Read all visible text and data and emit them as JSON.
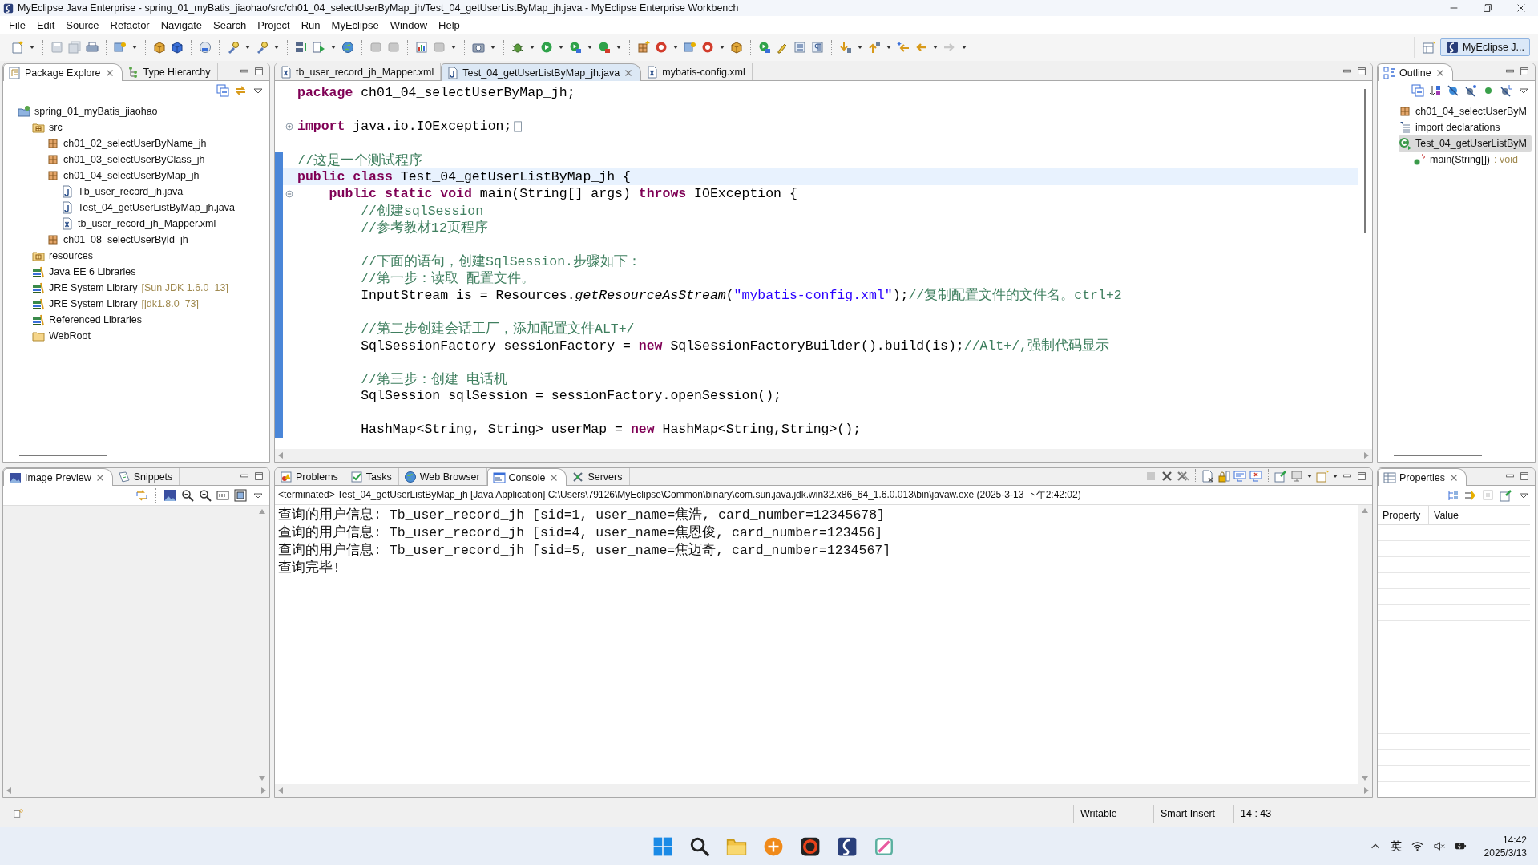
{
  "window": {
    "title": "MyEclipse Java Enterprise - spring_01_myBatis_jiaohao/src/ch01_04_selectUserByMap_jh/Test_04_getUserListByMap_jh.java - MyEclipse Enterprise Workbench"
  },
  "menu": [
    "File",
    "Edit",
    "Source",
    "Refactor",
    "Navigate",
    "Search",
    "Project",
    "Run",
    "MyEclipse",
    "Window",
    "Help"
  ],
  "perspective": {
    "label": "MyEclipse J...",
    "selected": true
  },
  "package_explorer": {
    "tabs": [
      {
        "kind": "package-explorer",
        "label": "Package Explore",
        "selected": true
      },
      {
        "kind": "hierarchy",
        "label": "Type Hierarchy",
        "selected": false
      }
    ],
    "tree": [
      {
        "kind": "project",
        "label": "spring_01_myBatis_jiaohao",
        "children": [
          {
            "kind": "source-folder",
            "label": "src",
            "children": [
              {
                "kind": "package",
                "label": "ch01_02_selectUserByName_jh"
              },
              {
                "kind": "package",
                "label": "ch01_03_selectUserByClass_jh"
              },
              {
                "kind": "package",
                "label": "ch01_04_selectUserByMap_jh",
                "children": [
                  {
                    "kind": "java",
                    "label": "Tb_user_record_jh.java"
                  },
                  {
                    "kind": "java",
                    "label": "Test_04_getUserListByMap_jh.java"
                  },
                  {
                    "kind": "xml",
                    "label": "tb_user_record_jh_Mapper.xml"
                  }
                ]
              },
              {
                "kind": "package",
                "label": "ch01_08_selectUserById_jh"
              }
            ]
          },
          {
            "kind": "source-folder",
            "label": "resources"
          },
          {
            "kind": "library",
            "label": "Java EE 6 Libraries"
          },
          {
            "kind": "library",
            "label": "JRE System Library",
            "detail": "[Sun JDK 1.6.0_13]"
          },
          {
            "kind": "library",
            "label": "JRE System Library",
            "detail": "[jdk1.8.0_73]"
          },
          {
            "kind": "library",
            "label": "Referenced Libraries"
          },
          {
            "kind": "folder",
            "label": "WebRoot"
          }
        ]
      }
    ]
  },
  "editor": {
    "tabs": [
      {
        "kind": "xml",
        "label": "tb_user_record_jh_Mapper.xml",
        "selected": false
      },
      {
        "kind": "java",
        "label": "Test_04_getUserListByMap_jh.java",
        "selected": true
      },
      {
        "kind": "xml",
        "label": "mybatis-config.xml",
        "selected": false
      }
    ],
    "lines": [
      {
        "current": false,
        "range": false,
        "segments": [
          {
            "kind": "keyword",
            "text": "package"
          },
          {
            "kind": "plain",
            "text": " ch01_04_selectUserByMap_jh;"
          }
        ]
      },
      {
        "current": false,
        "range": false
      },
      {
        "current": false,
        "collapsed": true,
        "range": false,
        "segments": [
          {
            "kind": "keyword",
            "text": "import"
          },
          {
            "kind": "plain",
            "text": " java.io.IOException;"
          }
        ]
      },
      {
        "current": false,
        "range": false
      },
      {
        "current": false,
        "range": true,
        "segments": [
          {
            "kind": "comment",
            "text": "//这是一个测试程序"
          }
        ]
      },
      {
        "current": true,
        "range": true,
        "segments": [
          {
            "kind": "keyword",
            "text": "public class"
          },
          {
            "kind": "plain",
            "text": " Test_04_getUserListByMap_jh {"
          }
        ]
      },
      {
        "current": false,
        "collapsed": false,
        "range": true,
        "segments": [
          {
            "kind": "keyword",
            "text": "    public static void"
          },
          {
            "kind": "plain",
            "text": " main(String[] args) "
          },
          {
            "kind": "keyword",
            "text": "throws"
          },
          {
            "kind": "plain",
            "text": " IOException {"
          }
        ]
      },
      {
        "current": false,
        "range": true,
        "segments": [
          {
            "kind": "comment",
            "text": "        //创建sqlSession"
          }
        ]
      },
      {
        "current": false,
        "range": true,
        "segments": [
          {
            "kind": "comment",
            "text": "        //参考教材12页程序"
          }
        ]
      },
      {
        "current": false,
        "range": true
      },
      {
        "current": false,
        "range": true,
        "segments": [
          {
            "kind": "comment",
            "text": "        //下面的语句，创建SqlSession.步骤如下："
          }
        ]
      },
      {
        "current": false,
        "range": true,
        "segments": [
          {
            "kind": "comment",
            "text": "        //第一步：读取 配置文件。"
          }
        ]
      },
      {
        "current": false,
        "range": true,
        "segments": [
          {
            "kind": "plain",
            "text": "        InputStream is = Resources."
          },
          {
            "kind": "static-call",
            "text": "getResourceAsStream"
          },
          {
            "kind": "plain",
            "text": "("
          },
          {
            "kind": "string",
            "text": "\"mybatis-config.xml\""
          },
          {
            "kind": "plain",
            "text": ");"
          },
          {
            "kind": "comment",
            "text": "//复制配置文件的文件名。ctrl+2"
          }
        ]
      },
      {
        "current": false,
        "range": true
      },
      {
        "current": false,
        "range": true,
        "segments": [
          {
            "kind": "comment",
            "text": "        //第二步创建会话工厂，添加配置文件ALT+/"
          }
        ]
      },
      {
        "current": false,
        "range": true,
        "segments": [
          {
            "kind": "plain",
            "text": "        SqlSessionFactory sessionFactory = "
          },
          {
            "kind": "keyword",
            "text": "new"
          },
          {
            "kind": "plain",
            "text": " SqlSessionFactoryBuilder().build(is);"
          },
          {
            "kind": "comment",
            "text": "//Alt+/,强制代码显示"
          }
        ]
      },
      {
        "current": false,
        "range": true
      },
      {
        "current": false,
        "range": true,
        "segments": [
          {
            "kind": "comment",
            "text": "        //第三步：创建 电话机"
          }
        ]
      },
      {
        "current": false,
        "range": true,
        "segments": [
          {
            "kind": "plain",
            "text": "        SqlSession sqlSession = sessionFactory.openSession();"
          }
        ]
      },
      {
        "current": false,
        "range": true
      },
      {
        "current": false,
        "range": true,
        "segments": [
          {
            "kind": "plain",
            "text": "        HashMap<String, String> userMap = "
          },
          {
            "kind": "keyword",
            "text": "new"
          },
          {
            "kind": "plain",
            "text": " HashMap<String,String>();"
          }
        ]
      }
    ]
  },
  "outline": {
    "tabs": [
      {
        "kind": "outline",
        "label": "Outline",
        "selected": true
      }
    ],
    "items": [
      {
        "kind": "package",
        "label": "ch01_04_selectUserByM",
        "selected": false
      },
      {
        "kind": "imports",
        "label": "import declarations",
        "selected": false
      },
      {
        "kind": "class",
        "label": "Test_04_getUserListByM",
        "selected": true,
        "children": [
          {
            "kind": "method",
            "label": "main(String[])",
            "suffix": ": void",
            "selected": false
          }
        ]
      }
    ]
  },
  "image_preview": {
    "tabs": [
      {
        "kind": "image",
        "label": "Image Preview",
        "selected": true
      },
      {
        "kind": "snippets",
        "label": "Snippets",
        "selected": false
      }
    ]
  },
  "console": {
    "tabs": [
      {
        "kind": "problems",
        "label": "Problems",
        "selected": false
      },
      {
        "kind": "tasks",
        "label": "Tasks",
        "selected": false
      },
      {
        "kind": "browser",
        "label": "Web Browser",
        "selected": false
      },
      {
        "kind": "console",
        "label": "Console",
        "selected": true
      },
      {
        "kind": "servers",
        "label": "Servers",
        "selected": false
      }
    ],
    "header": "<terminated> Test_04_getUserListByMap_jh [Java Application] C:\\Users\\79126\\MyEclipse\\Common\\binary\\com.sun.java.jdk.win32.x86_64_1.6.0.013\\bin\\javaw.exe (2025-3-13 下午2:42:02)",
    "lines": [
      "查询的用户信息: Tb_user_record_jh [sid=1, user_name=焦浩, card_number=12345678]",
      "查询的用户信息: Tb_user_record_jh [sid=4, user_name=焦恩俊, card_number=123456]",
      "查询的用户信息: Tb_user_record_jh [sid=5, user_name=焦迈奇, card_number=1234567]",
      "查询完毕!"
    ]
  },
  "properties": {
    "tabs": [
      {
        "kind": "properties",
        "label": "Properties",
        "selected": true
      }
    ],
    "columns": [
      "Property",
      "Value"
    ]
  },
  "status_bar": {
    "fields": [
      "Writable",
      "Smart Insert",
      "14 : 43"
    ]
  },
  "taskbar": {
    "ime": "英",
    "time": "14:42",
    "date": "2025/3/13"
  }
}
